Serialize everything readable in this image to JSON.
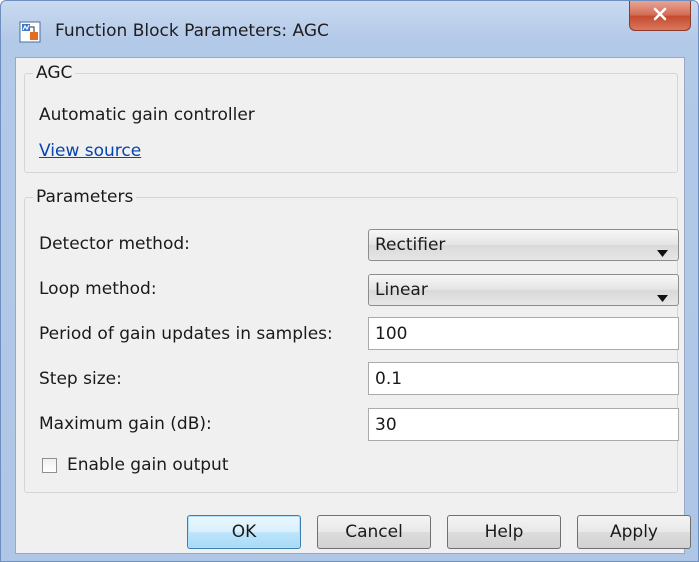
{
  "window": {
    "title": "Function Block Parameters: AGC"
  },
  "agc_group": {
    "legend": "AGC",
    "description": "Automatic gain controller",
    "link": "View source"
  },
  "parameters": {
    "legend": "Parameters",
    "detector_method": {
      "label": "Detector method:",
      "value": "Rectifier"
    },
    "loop_method": {
      "label": "Loop method:",
      "value": "Linear"
    },
    "period": {
      "label": "Period of gain updates in samples:",
      "value": "100"
    },
    "step_size": {
      "label": "Step size:",
      "value": "0.1"
    },
    "max_gain": {
      "label": "Maximum gain (dB):",
      "value": "30"
    },
    "enable_gain_output": {
      "label": "Enable gain output",
      "checked": false
    }
  },
  "buttons": {
    "ok": "OK",
    "cancel": "Cancel",
    "help": "Help",
    "apply": "Apply"
  },
  "icons": {
    "app": "simulink-block-icon",
    "close": "close-icon",
    "dropdown": "chevron-down-icon"
  }
}
